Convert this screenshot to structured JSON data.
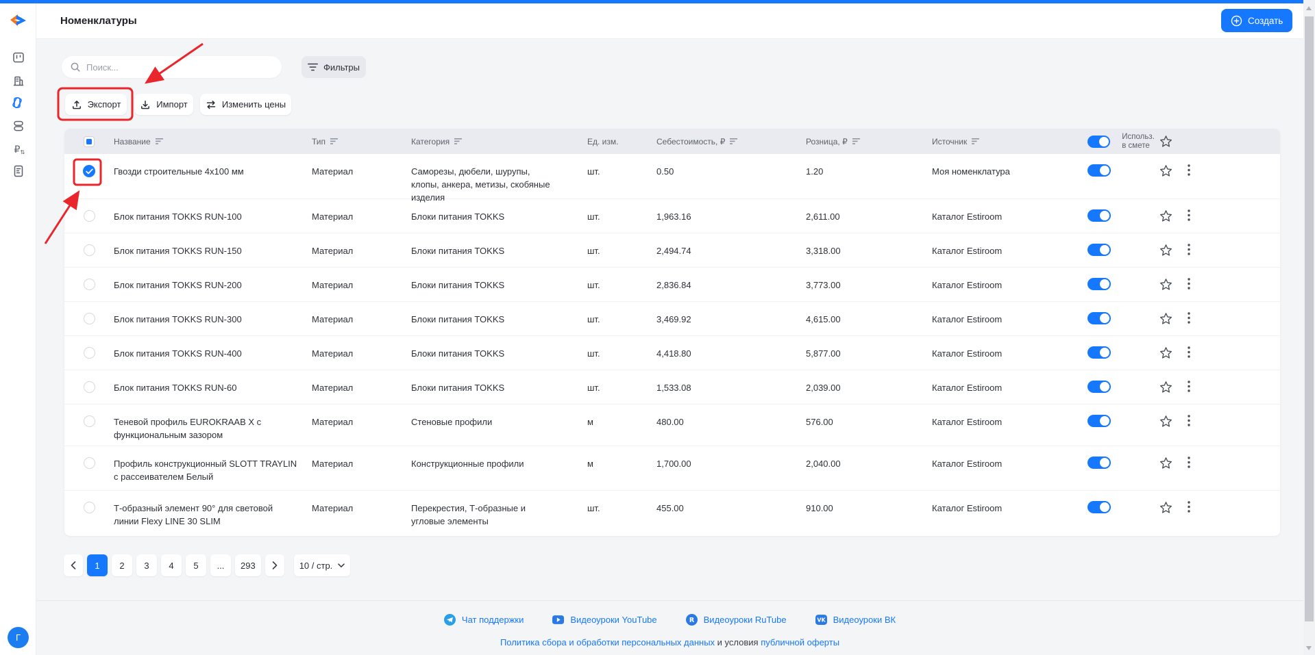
{
  "colors": {
    "accent": "#1677ff",
    "annotation_red": "#e8262b",
    "header_band": "#e9ebf0",
    "page_bg": "#f4f5f7"
  },
  "app": {
    "title": "Номенклатуры",
    "create_label": "Создать",
    "avatar_letter": "Г"
  },
  "sidebar": {
    "items": [
      {
        "icon": "projects-icon"
      },
      {
        "icon": "company-icon"
      },
      {
        "icon": "nomenclature-icon",
        "active": true
      },
      {
        "icon": "objects-icon"
      },
      {
        "icon": "prices-icon"
      },
      {
        "icon": "documents-icon"
      }
    ]
  },
  "toolbar": {
    "search_placeholder": "Поиск...",
    "filters_label": "Фильтры",
    "export_label": "Экспорт",
    "import_label": "Импорт",
    "change_prices_label": "Изменить цены"
  },
  "table": {
    "headers": {
      "name": "Название",
      "type": "Тип",
      "category": "Категория",
      "unit": "Ед. изм.",
      "cost": "Себестоимость, ₽",
      "retail": "Розница, ₽",
      "source": "Источник",
      "use_in_estimate": "Использ. в смете"
    },
    "rows": [
      {
        "checked": true,
        "name": "Гвозди строительные 4x100 мм",
        "type": "Материал",
        "category": "Саморезы, дюбели, шурупы, клопы, анкера, метизы, скобяные изделия",
        "unit": "шт.",
        "cost": "0.50",
        "retail": "1.20",
        "source": "Моя номенклатура",
        "toggle_on": true
      },
      {
        "checked": false,
        "name": "Блок питания TOKKS RUN-100",
        "type": "Материал",
        "category": "Блоки питания TOKKS",
        "unit": "шт.",
        "cost": "1,963.16",
        "retail": "2,611.00",
        "source": "Каталог Estiroom",
        "toggle_on": true
      },
      {
        "checked": false,
        "name": "Блок питания TOKKS RUN-150",
        "type": "Материал",
        "category": "Блоки питания TOKKS",
        "unit": "шт.",
        "cost": "2,494.74",
        "retail": "3,318.00",
        "source": "Каталог Estiroom",
        "toggle_on": true
      },
      {
        "checked": false,
        "name": "Блок питания TOKKS RUN-200",
        "type": "Материал",
        "category": "Блоки питания TOKKS",
        "unit": "шт.",
        "cost": "2,836.84",
        "retail": "3,773.00",
        "source": "Каталог Estiroom",
        "toggle_on": true
      },
      {
        "checked": false,
        "name": "Блок питания TOKKS RUN-300",
        "type": "Материал",
        "category": "Блоки питания TOKKS",
        "unit": "шт.",
        "cost": "3,469.92",
        "retail": "4,615.00",
        "source": "Каталог Estiroom",
        "toggle_on": true
      },
      {
        "checked": false,
        "name": "Блок питания TOKKS RUN-400",
        "type": "Материал",
        "category": "Блоки питания TOKKS",
        "unit": "шт.",
        "cost": "4,418.80",
        "retail": "5,877.00",
        "source": "Каталог Estiroom",
        "toggle_on": true
      },
      {
        "checked": false,
        "name": "Блок питания TOKKS RUN-60",
        "type": "Материал",
        "category": "Блоки питания TOKKS",
        "unit": "шт.",
        "cost": "1,533.08",
        "retail": "2,039.00",
        "source": "Каталог Estiroom",
        "toggle_on": true
      },
      {
        "checked": false,
        "name": "Теневой профиль EUROKRAAB X с функциональным зазором",
        "type": "Материал",
        "category": "Стеновые профили",
        "unit": "м",
        "cost": "480.00",
        "retail": "576.00",
        "source": "Каталог Estiroom",
        "toggle_on": true
      },
      {
        "checked": false,
        "name": "Профиль конструкционный SLOTT TRAYLIN с рассеивателем Белый",
        "type": "Материал",
        "category": "Конструкционные профили",
        "unit": "м",
        "cost": "1,700.00",
        "retail": "2,040.00",
        "source": "Каталог Estiroom",
        "toggle_on": true
      },
      {
        "checked": false,
        "name": "Т-образный элемент 90° для световой линии Flexy LINE 30 SLIM",
        "type": "Материал",
        "category": "Перекрестия, Т-образные и угловые элементы",
        "unit": "шт.",
        "cost": "455.00",
        "retail": "910.00",
        "source": "Каталог Estiroom",
        "toggle_on": true
      }
    ]
  },
  "pagination": {
    "pages": [
      "1",
      "2",
      "3",
      "4",
      "5",
      "...",
      "293"
    ],
    "active_page": "1",
    "page_size": "10 / стр."
  },
  "footer": {
    "links": [
      {
        "icon": "telegram-icon",
        "label": "Чат поддержки"
      },
      {
        "icon": "youtube-icon",
        "label": "Видеоуроки YouTube"
      },
      {
        "icon": "rutube-icon",
        "label": "Видеоуроки RuTube"
      },
      {
        "icon": "vk-icon",
        "label": "Видеоуроки ВК"
      }
    ],
    "legal": {
      "policy": "Политика сбора и обработки персональных данных",
      "middle": " и условия ",
      "offer": "публичной оферты"
    }
  },
  "annotations": {
    "color": "#e8262b"
  }
}
